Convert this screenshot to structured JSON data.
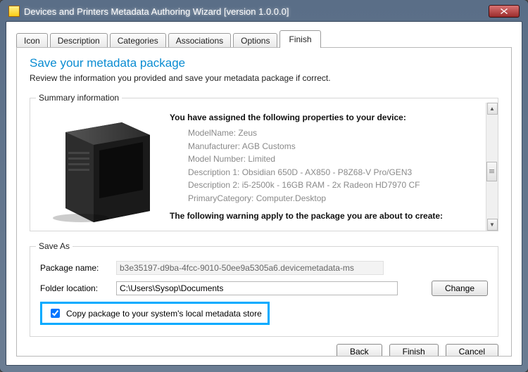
{
  "window": {
    "title": "Devices and Printers Metadata Authoring Wizard [version 1.0.0.0]"
  },
  "tabs": {
    "items": [
      {
        "label": "Icon"
      },
      {
        "label": "Description"
      },
      {
        "label": "Categories"
      },
      {
        "label": "Associations"
      },
      {
        "label": "Options"
      },
      {
        "label": "Finish"
      }
    ],
    "active_index": 5
  },
  "page": {
    "heading": "Save your metadata package",
    "subtitle": "Review the information you provided and save your metadata package if correct."
  },
  "summary": {
    "legend": "Summary information",
    "lead": "You have assigned the following properties to your device:",
    "rows": {
      "modelName": "ModelName: Zeus",
      "manufacturer": "Manufacturer: AGB Customs",
      "modelNumber": "Model Number: Limited",
      "desc1": "Description 1: Obsidian 650D - AX850 - P8Z68-V Pro/GEN3",
      "desc2": "Description 2: i5-2500k - 16GB RAM - 2x Radeon HD7970 CF",
      "primaryCategory": "PrimaryCategory: Computer.Desktop"
    },
    "warning": "The following warning apply to the package you are about to create:"
  },
  "saveAs": {
    "legend": "Save As",
    "packageName": {
      "label": "Package name:",
      "value": "b3e35197-d9ba-4fcc-9010-50ee9a5305a6.devicemetadata-ms"
    },
    "folder": {
      "label": "Folder location:",
      "value": "C:\\Users\\Sysop\\Documents"
    },
    "changeButton": "Change",
    "checkboxLabel": "Copy package to your system's local metadata store",
    "checkboxChecked": true
  },
  "footer": {
    "back": "Back",
    "finish": "Finish",
    "cancel": "Cancel"
  }
}
